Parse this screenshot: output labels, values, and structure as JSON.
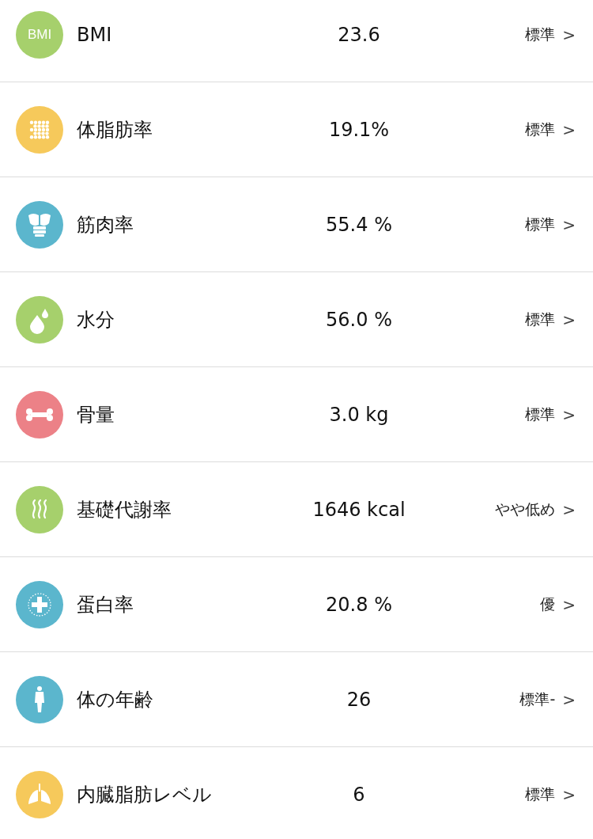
{
  "metrics": [
    {
      "kind": "bmi",
      "icon_text": "BMI",
      "color": "#a6d06c",
      "label": "BMI",
      "value": "23.6",
      "status": "標準",
      "chevron": ">"
    },
    {
      "kind": "fat",
      "color": "#f6c95b",
      "label": "体脂肪率",
      "value": "19.1%",
      "status": "標準",
      "chevron": ">"
    },
    {
      "kind": "muscle",
      "color": "#5bb6cd",
      "label": "筋肉率",
      "value": "55.4 %",
      "status": "標準",
      "chevron": ">"
    },
    {
      "kind": "water",
      "color": "#a6d06c",
      "label": "水分",
      "value": "56.0 %",
      "status": "標準",
      "chevron": ">"
    },
    {
      "kind": "bone",
      "color": "#ec8187",
      "label": "骨量",
      "value": "3.0 kg",
      "status": "標準",
      "chevron": ">"
    },
    {
      "kind": "metabolism",
      "color": "#a6d06c",
      "label": "基礎代謝率",
      "value": "1646 kcal",
      "status": "やや低め",
      "chevron": ">"
    },
    {
      "kind": "protein",
      "color": "#5bb6cd",
      "label": "蛋白率",
      "value": "20.8 %",
      "status": "優",
      "chevron": ">"
    },
    {
      "kind": "age",
      "color": "#5bb6cd",
      "label": "体の年齢",
      "value": "26",
      "status": "標準-",
      "chevron": ">"
    },
    {
      "kind": "visceral",
      "color": "#f6c95b",
      "label": "内臓脂肪レベル",
      "value": "6",
      "status": "標準",
      "chevron": ">"
    }
  ]
}
